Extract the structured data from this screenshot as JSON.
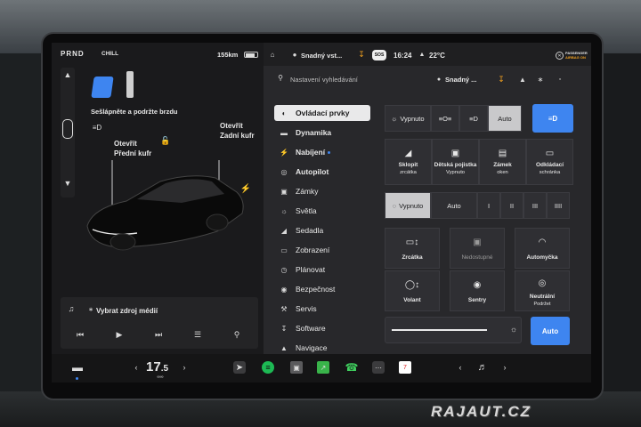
{
  "statusbar": {
    "gears": "PRND",
    "drive_mode": "CHILL",
    "range": "155km",
    "profile": "Snadný vst...",
    "time": "16:24",
    "temperature": "22°C",
    "sos": "SOS",
    "airbag_line1": "PASSENGER",
    "airbag_line2": "AIRBAG ON"
  },
  "car": {
    "brake_msg": "Sešlápněte a podržte brzdu",
    "front_trunk_1": "Otevřít",
    "front_trunk_2": "Přední kufr",
    "rear_trunk_1": "Otevřít",
    "rear_trunk_2": "Zadní kufr"
  },
  "media": {
    "source_label": "Vybrat zdroj médií"
  },
  "search": {
    "placeholder": "Nastavení vyhledávání",
    "profile": "Snadný ..."
  },
  "menu": [
    {
      "label": "Ovládací prvky",
      "icon": "toggle-icon"
    },
    {
      "label": "Dynamika",
      "icon": "car-icon"
    },
    {
      "label": "Nabíjení",
      "icon": "bolt-icon"
    },
    {
      "label": "Autopilot",
      "icon": "steering-icon"
    },
    {
      "label": "Zámky",
      "icon": "lock-icon"
    },
    {
      "label": "Světla",
      "icon": "sun-icon"
    },
    {
      "label": "Sedadla",
      "icon": "seat-icon"
    },
    {
      "label": "Zobrazení",
      "icon": "display-icon"
    },
    {
      "label": "Plánovat",
      "icon": "clock-icon"
    },
    {
      "label": "Bezpečnost",
      "icon": "shield-icon"
    },
    {
      "label": "Servis",
      "icon": "wrench-icon"
    },
    {
      "label": "Software",
      "icon": "download-icon"
    },
    {
      "label": "Navigace",
      "icon": "navigation-icon"
    }
  ],
  "lights": {
    "off": "Vypnuto",
    "auto": "Auto"
  },
  "quick": [
    {
      "line1": "Sklopit",
      "line2": "zrcátka"
    },
    {
      "line1": "Dětská pojistka",
      "line2": "Vypnuto"
    },
    {
      "line1": "Zámek",
      "line2": "oken"
    },
    {
      "line1": "Odkládací",
      "line2": "schránka"
    }
  ],
  "wipers": {
    "off": "Vypnuto",
    "auto": "Auto",
    "s1": "I",
    "s2": "II",
    "s3": "III",
    "s4": "IIII"
  },
  "tiles": {
    "mirrors": "Zrcátka",
    "unavailable": "Nedostupné",
    "glovebox": "Automyčka",
    "wheel": "Volant",
    "sentry": "Sentry",
    "neutral_1": "Neutrální",
    "neutral_2": "Podržet"
  },
  "brightness": {
    "auto": "Auto",
    "level": 0.85
  },
  "dock": {
    "temp_int": "17",
    "temp_dec": ".5"
  },
  "watermark": "RAJAUT.CZ"
}
